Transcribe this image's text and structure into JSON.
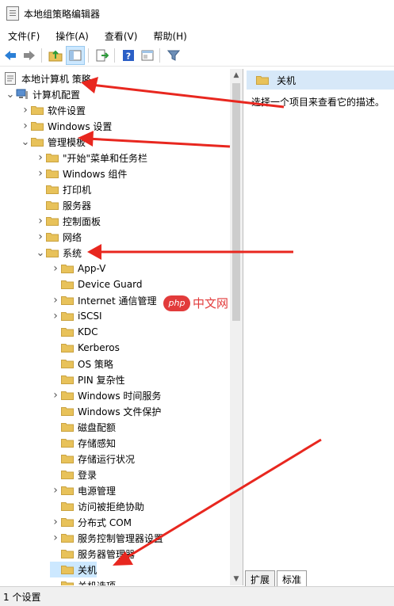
{
  "window": {
    "title": "本地组策略编辑器"
  },
  "menu": [
    "文件(F)",
    "操作(A)",
    "查看(V)",
    "帮助(H)"
  ],
  "toolbar_icons": [
    "back-icon",
    "forward-icon",
    "up-folder-icon",
    "show-hide-tree-icon",
    "export-icon",
    "help-icon",
    "properties-icon",
    "filter-icon"
  ],
  "tree": [
    {
      "label": "本地计算机 策略",
      "depth": 0,
      "arrow": "",
      "icon": "policy"
    },
    {
      "label": "计算机配置",
      "depth": 0,
      "arrow": "open",
      "icon": "computer"
    },
    {
      "label": "软件设置",
      "depth": 1,
      "arrow": "closed",
      "icon": "folder"
    },
    {
      "label": "Windows 设置",
      "depth": 1,
      "arrow": "closed",
      "icon": "folder"
    },
    {
      "label": "管理模板",
      "depth": 1,
      "arrow": "open",
      "icon": "folder"
    },
    {
      "label": "\"开始\"菜单和任务栏",
      "depth": 2,
      "arrow": "closed",
      "icon": "folder"
    },
    {
      "label": "Windows 组件",
      "depth": 2,
      "arrow": "closed",
      "icon": "folder"
    },
    {
      "label": "打印机",
      "depth": 2,
      "arrow": "",
      "icon": "folder"
    },
    {
      "label": "服务器",
      "depth": 2,
      "arrow": "",
      "icon": "folder"
    },
    {
      "label": "控制面板",
      "depth": 2,
      "arrow": "closed",
      "icon": "folder"
    },
    {
      "label": "网络",
      "depth": 2,
      "arrow": "closed",
      "icon": "folder"
    },
    {
      "label": "系统",
      "depth": 2,
      "arrow": "open",
      "icon": "folder"
    },
    {
      "label": "App-V",
      "depth": 3,
      "arrow": "closed",
      "icon": "folder"
    },
    {
      "label": "Device Guard",
      "depth": 3,
      "arrow": "",
      "icon": "folder"
    },
    {
      "label": "Internet 通信管理",
      "depth": 3,
      "arrow": "closed",
      "icon": "folder"
    },
    {
      "label": "iSCSI",
      "depth": 3,
      "arrow": "closed",
      "icon": "folder"
    },
    {
      "label": "KDC",
      "depth": 3,
      "arrow": "",
      "icon": "folder"
    },
    {
      "label": "Kerberos",
      "depth": 3,
      "arrow": "",
      "icon": "folder"
    },
    {
      "label": "OS 策略",
      "depth": 3,
      "arrow": "",
      "icon": "folder"
    },
    {
      "label": "PIN 复杂性",
      "depth": 3,
      "arrow": "",
      "icon": "folder"
    },
    {
      "label": "Windows 时间服务",
      "depth": 3,
      "arrow": "closed",
      "icon": "folder"
    },
    {
      "label": "Windows 文件保护",
      "depth": 3,
      "arrow": "",
      "icon": "folder"
    },
    {
      "label": "磁盘配额",
      "depth": 3,
      "arrow": "",
      "icon": "folder"
    },
    {
      "label": "存储感知",
      "depth": 3,
      "arrow": "",
      "icon": "folder"
    },
    {
      "label": "存储运行状况",
      "depth": 3,
      "arrow": "",
      "icon": "folder"
    },
    {
      "label": "登录",
      "depth": 3,
      "arrow": "",
      "icon": "folder"
    },
    {
      "label": "电源管理",
      "depth": 3,
      "arrow": "closed",
      "icon": "folder"
    },
    {
      "label": "访问被拒绝协助",
      "depth": 3,
      "arrow": "",
      "icon": "folder"
    },
    {
      "label": "分布式 COM",
      "depth": 3,
      "arrow": "closed",
      "icon": "folder"
    },
    {
      "label": "服务控制管理器设置",
      "depth": 3,
      "arrow": "closed",
      "icon": "folder"
    },
    {
      "label": "服务器管理器",
      "depth": 3,
      "arrow": "",
      "icon": "folder"
    },
    {
      "label": "关机",
      "depth": 3,
      "arrow": "",
      "icon": "folder",
      "selected": true
    },
    {
      "label": "关机选项",
      "depth": 3,
      "arrow": "",
      "icon": "folder"
    }
  ],
  "right_pane": {
    "header": "关机",
    "description": "选择一个项目来查看它的描述。"
  },
  "tabs": [
    "扩展",
    "标准"
  ],
  "status": "1 个设置",
  "watermark": {
    "logo": "php",
    "text": "中文网"
  },
  "colors": {
    "folder": "#e8c25a",
    "selection": "#cce8ff",
    "annotation": "#e8271f"
  }
}
